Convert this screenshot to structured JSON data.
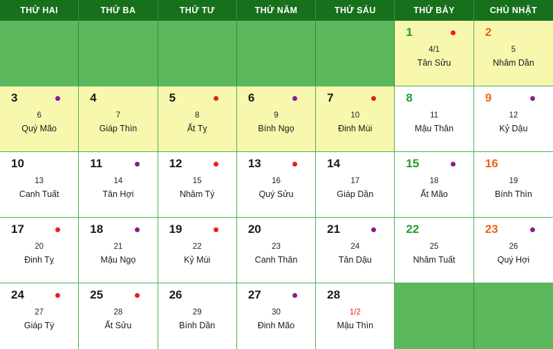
{
  "header": {
    "weekdays": [
      "THỨ HAI",
      "THỨ BA",
      "THỨ TƯ",
      "THỨ NĂM",
      "THỨ SÁU",
      "THỨ BẢY",
      "CHỦ NHẬT"
    ]
  },
  "colors": {
    "header_bg": "#17701c",
    "header_text": "#ffffff",
    "cell_green": "#5cb85c",
    "cell_yellow": "#f7f7ae",
    "cell_white": "#ffffff",
    "grid_line": "#4caf50",
    "saturday_text": "#1f9d2e",
    "sunday_text": "#ec6316",
    "weekday_text": "#1a1a1a",
    "dot_red": "#e8201e",
    "dot_purple": "#8e1b8e",
    "lunar_newmonth_text": "#e8201e"
  },
  "weeks": [
    [
      {
        "empty": true,
        "bg": "green",
        "day": "",
        "lunar_day": "",
        "lunar_name": "",
        "dot": "none",
        "num_color": "weekday"
      },
      {
        "empty": true,
        "bg": "green",
        "day": "",
        "lunar_day": "",
        "lunar_name": "",
        "dot": "none",
        "num_color": "weekday"
      },
      {
        "empty": true,
        "bg": "green",
        "day": "",
        "lunar_day": "",
        "lunar_name": "",
        "dot": "none",
        "num_color": "weekday"
      },
      {
        "empty": true,
        "bg": "green",
        "day": "",
        "lunar_day": "",
        "lunar_name": "",
        "dot": "none",
        "num_color": "weekday"
      },
      {
        "empty": true,
        "bg": "green",
        "day": "",
        "lunar_day": "",
        "lunar_name": "",
        "dot": "none",
        "num_color": "weekday"
      },
      {
        "empty": false,
        "bg": "yellow",
        "day": "1",
        "lunar_day": "4/1",
        "lunar_name": "Tân Sửu",
        "dot": "red",
        "num_color": "sat",
        "lunar_newmonth": false
      },
      {
        "empty": false,
        "bg": "yellow",
        "day": "2",
        "lunar_day": "5",
        "lunar_name": "Nhâm Dần",
        "dot": "none",
        "num_color": "sun",
        "lunar_newmonth": false
      }
    ],
    [
      {
        "empty": false,
        "bg": "yellow",
        "day": "3",
        "lunar_day": "6",
        "lunar_name": "Quý Mão",
        "dot": "purple",
        "num_color": "weekday"
      },
      {
        "empty": false,
        "bg": "yellow",
        "day": "4",
        "lunar_day": "7",
        "lunar_name": "Giáp Thìn",
        "dot": "none",
        "num_color": "weekday"
      },
      {
        "empty": false,
        "bg": "yellow",
        "day": "5",
        "lunar_day": "8",
        "lunar_name": "Ất Tỵ",
        "dot": "red",
        "num_color": "weekday"
      },
      {
        "empty": false,
        "bg": "yellow",
        "day": "6",
        "lunar_day": "9",
        "lunar_name": "Bính Ngọ",
        "dot": "purple",
        "num_color": "weekday"
      },
      {
        "empty": false,
        "bg": "yellow",
        "day": "7",
        "lunar_day": "10",
        "lunar_name": "Đinh Mùi",
        "dot": "red",
        "num_color": "weekday"
      },
      {
        "empty": false,
        "bg": "white",
        "day": "8",
        "lunar_day": "11",
        "lunar_name": "Mậu Thân",
        "dot": "none",
        "num_color": "sat"
      },
      {
        "empty": false,
        "bg": "white",
        "day": "9",
        "lunar_day": "12",
        "lunar_name": "Kỷ Dậu",
        "dot": "purple",
        "num_color": "sun"
      }
    ],
    [
      {
        "empty": false,
        "bg": "white",
        "day": "10",
        "lunar_day": "13",
        "lunar_name": "Canh Tuất",
        "dot": "none",
        "num_color": "weekday"
      },
      {
        "empty": false,
        "bg": "white",
        "day": "11",
        "lunar_day": "14",
        "lunar_name": "Tân Hợi",
        "dot": "purple",
        "num_color": "weekday"
      },
      {
        "empty": false,
        "bg": "white",
        "day": "12",
        "lunar_day": "15",
        "lunar_name": "Nhâm Tý",
        "dot": "red",
        "num_color": "weekday"
      },
      {
        "empty": false,
        "bg": "white",
        "day": "13",
        "lunar_day": "16",
        "lunar_name": "Quý Sửu",
        "dot": "red",
        "num_color": "weekday"
      },
      {
        "empty": false,
        "bg": "white",
        "day": "14",
        "lunar_day": "17",
        "lunar_name": "Giáp Dần",
        "dot": "none",
        "num_color": "weekday"
      },
      {
        "empty": false,
        "bg": "white",
        "day": "15",
        "lunar_day": "18",
        "lunar_name": "Ất Mão",
        "dot": "purple",
        "num_color": "sat"
      },
      {
        "empty": false,
        "bg": "white",
        "day": "16",
        "lunar_day": "19",
        "lunar_name": "Bính Thìn",
        "dot": "none",
        "num_color": "sun"
      }
    ],
    [
      {
        "empty": false,
        "bg": "white",
        "day": "17",
        "lunar_day": "20",
        "lunar_name": "Đinh Tỵ",
        "dot": "red",
        "num_color": "weekday"
      },
      {
        "empty": false,
        "bg": "white",
        "day": "18",
        "lunar_day": "21",
        "lunar_name": "Mậu Ngọ",
        "dot": "purple",
        "num_color": "weekday"
      },
      {
        "empty": false,
        "bg": "white",
        "day": "19",
        "lunar_day": "22",
        "lunar_name": "Kỷ Mùi",
        "dot": "red",
        "num_color": "weekday"
      },
      {
        "empty": false,
        "bg": "white",
        "day": "20",
        "lunar_day": "23",
        "lunar_name": "Canh Thân",
        "dot": "none",
        "num_color": "weekday"
      },
      {
        "empty": false,
        "bg": "white",
        "day": "21",
        "lunar_day": "24",
        "lunar_name": "Tân Dậu",
        "dot": "purple",
        "num_color": "weekday"
      },
      {
        "empty": false,
        "bg": "white",
        "day": "22",
        "lunar_day": "25",
        "lunar_name": "Nhâm Tuất",
        "dot": "none",
        "num_color": "sat"
      },
      {
        "empty": false,
        "bg": "white",
        "day": "23",
        "lunar_day": "26",
        "lunar_name": "Quý Hợi",
        "dot": "purple",
        "num_color": "sun"
      }
    ],
    [
      {
        "empty": false,
        "bg": "white",
        "day": "24",
        "lunar_day": "27",
        "lunar_name": "Giáp Tý",
        "dot": "red",
        "num_color": "weekday"
      },
      {
        "empty": false,
        "bg": "white",
        "day": "25",
        "lunar_day": "28",
        "lunar_name": "Ất Sửu",
        "dot": "red",
        "num_color": "weekday"
      },
      {
        "empty": false,
        "bg": "white",
        "day": "26",
        "lunar_day": "29",
        "lunar_name": "Bính Dần",
        "dot": "none",
        "num_color": "weekday"
      },
      {
        "empty": false,
        "bg": "white",
        "day": "27",
        "lunar_day": "30",
        "lunar_name": "Đinh Mão",
        "dot": "purple",
        "num_color": "weekday"
      },
      {
        "empty": false,
        "bg": "white",
        "day": "28",
        "lunar_day": "1/2",
        "lunar_name": "Mậu Thìn",
        "dot": "none",
        "num_color": "weekday",
        "lunar_newmonth": true
      },
      {
        "empty": true,
        "bg": "green",
        "day": "",
        "lunar_day": "",
        "lunar_name": "",
        "dot": "none",
        "num_color": "weekday"
      },
      {
        "empty": true,
        "bg": "green",
        "day": "",
        "lunar_day": "",
        "lunar_name": "",
        "dot": "none",
        "num_color": "weekday"
      }
    ]
  ]
}
